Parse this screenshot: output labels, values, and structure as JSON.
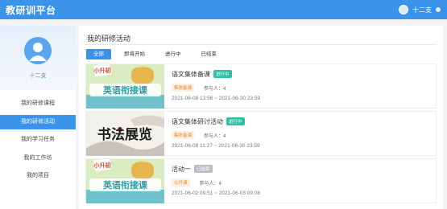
{
  "app": {
    "title": "教研训平台"
  },
  "user": {
    "name": "十二支"
  },
  "sidebar": {
    "name": "十二支",
    "items": [
      {
        "label": "我的研修课程",
        "active": false
      },
      {
        "label": "我的研修活动",
        "active": true
      },
      {
        "label": "我的学习任务",
        "active": false
      },
      {
        "label": "我的工作坊",
        "active": false
      },
      {
        "label": "我的项目",
        "active": false
      }
    ]
  },
  "main": {
    "title": "我的研修活动",
    "tabs": [
      {
        "label": "全部",
        "active": true
      },
      {
        "label": "即将开始",
        "active": false
      },
      {
        "label": "进行中",
        "active": false
      },
      {
        "label": "已结束",
        "active": false
      }
    ],
    "activities": [
      {
        "title": "语文集体备课",
        "status": "进行中",
        "status_color": "#2fc1a6",
        "tag": "集体备课",
        "tag_color": "#f08c2e",
        "tag_bg": "#fdf0e2",
        "participants": "参与人：4",
        "date": "2021-06-08 13:56 ~ 2021-06-30 23:59",
        "thumb_text": "英语衔接课",
        "thumb_badge": "小升初"
      },
      {
        "title": "语文集体研讨活动",
        "status": "进行中",
        "status_color": "#2fc1a6",
        "tag": "集体备课",
        "tag_color": "#f08c2e",
        "tag_bg": "#fdf0e2",
        "participants": "参与人：4",
        "date": "2021-06-08 11:27 ~ 2021-06-30 23:59",
        "thumb_text": "书法展览",
        "thumb_badge": ""
      },
      {
        "title": "活动一",
        "status": "已结束",
        "status_color": "#b9bec6",
        "tag": "公开课",
        "tag_color": "#f08c2e",
        "tag_bg": "#fdf0e2",
        "participants": "参与人：4",
        "date": "2021-06-02 09:51 ~ 2021-06-03 09:08",
        "thumb_text": "英语衔接课",
        "thumb_badge": "小升初"
      }
    ]
  },
  "colors": {
    "primary": "#3a93e8",
    "active_status": "#2fc1a6",
    "ended_status": "#b9bec6",
    "tag": "#f08c2e"
  }
}
